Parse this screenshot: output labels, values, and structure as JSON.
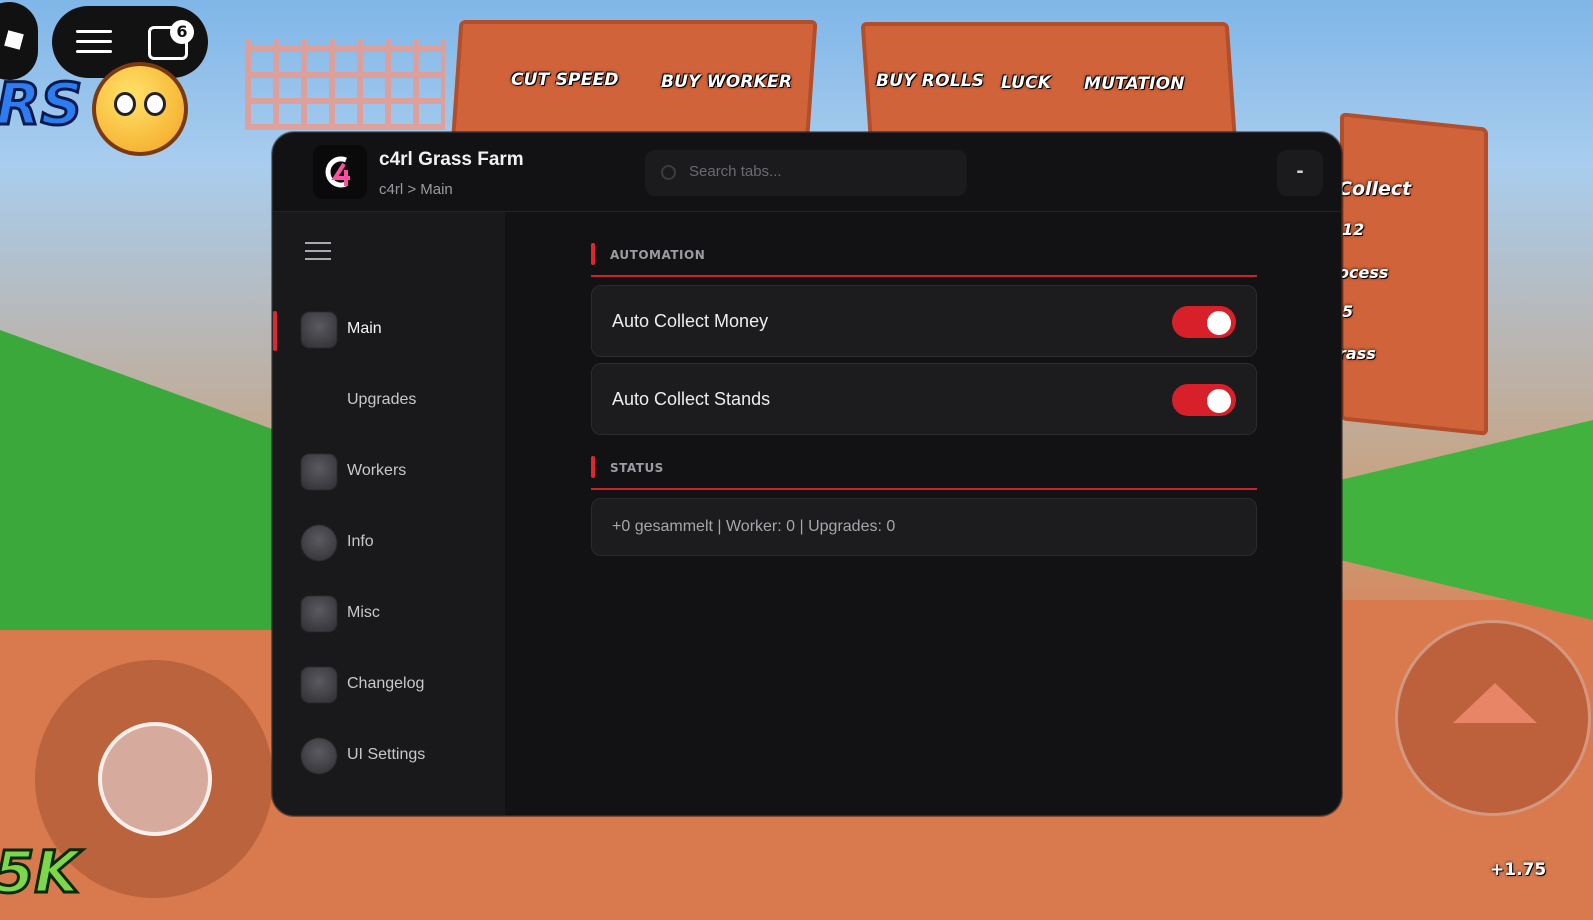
{
  "game": {
    "boards": [
      "CUT SPEED",
      "BUY WORKER",
      "BUY ROLLS",
      "LUCK",
      "MUTATION"
    ],
    "side_labels": [
      "Collect",
      "12",
      "ocess",
      "5",
      "rass"
    ],
    "hud_title_fragment": "RS",
    "chat_badge": "6",
    "cash": "5K",
    "bonus": "+1.75"
  },
  "app": {
    "title": "c4rl Grass Farm",
    "breadcrumb": "c4rl > Main",
    "search_placeholder": "Search tabs...",
    "minimize_label": "-"
  },
  "sidebar": {
    "items": [
      {
        "label": "Main",
        "icon": "home-icon",
        "active": true
      },
      {
        "label": "Upgrades",
        "icon": "",
        "active": false
      },
      {
        "label": "Workers",
        "icon": "workers-icon",
        "active": false
      },
      {
        "label": "Info",
        "icon": "info-icon",
        "active": false
      },
      {
        "label": "Misc",
        "icon": "misc-icon",
        "active": false
      },
      {
        "label": "Changelog",
        "icon": "changelog-icon",
        "active": false
      },
      {
        "label": "UI Settings",
        "icon": "settings-icon",
        "active": false
      }
    ]
  },
  "main": {
    "automation": {
      "heading": "AUTOMATION",
      "toggles": [
        {
          "label": "Auto Collect Money",
          "on": true
        },
        {
          "label": "Auto Collect Stands",
          "on": true
        }
      ]
    },
    "status": {
      "heading": "STATUS",
      "text": "+0 gesammelt | Worker: 0 | Upgrades: 0"
    }
  },
  "colors": {
    "accent": "#e0262f",
    "window_bg": "#121214",
    "sidebar_bg": "#19191b"
  }
}
